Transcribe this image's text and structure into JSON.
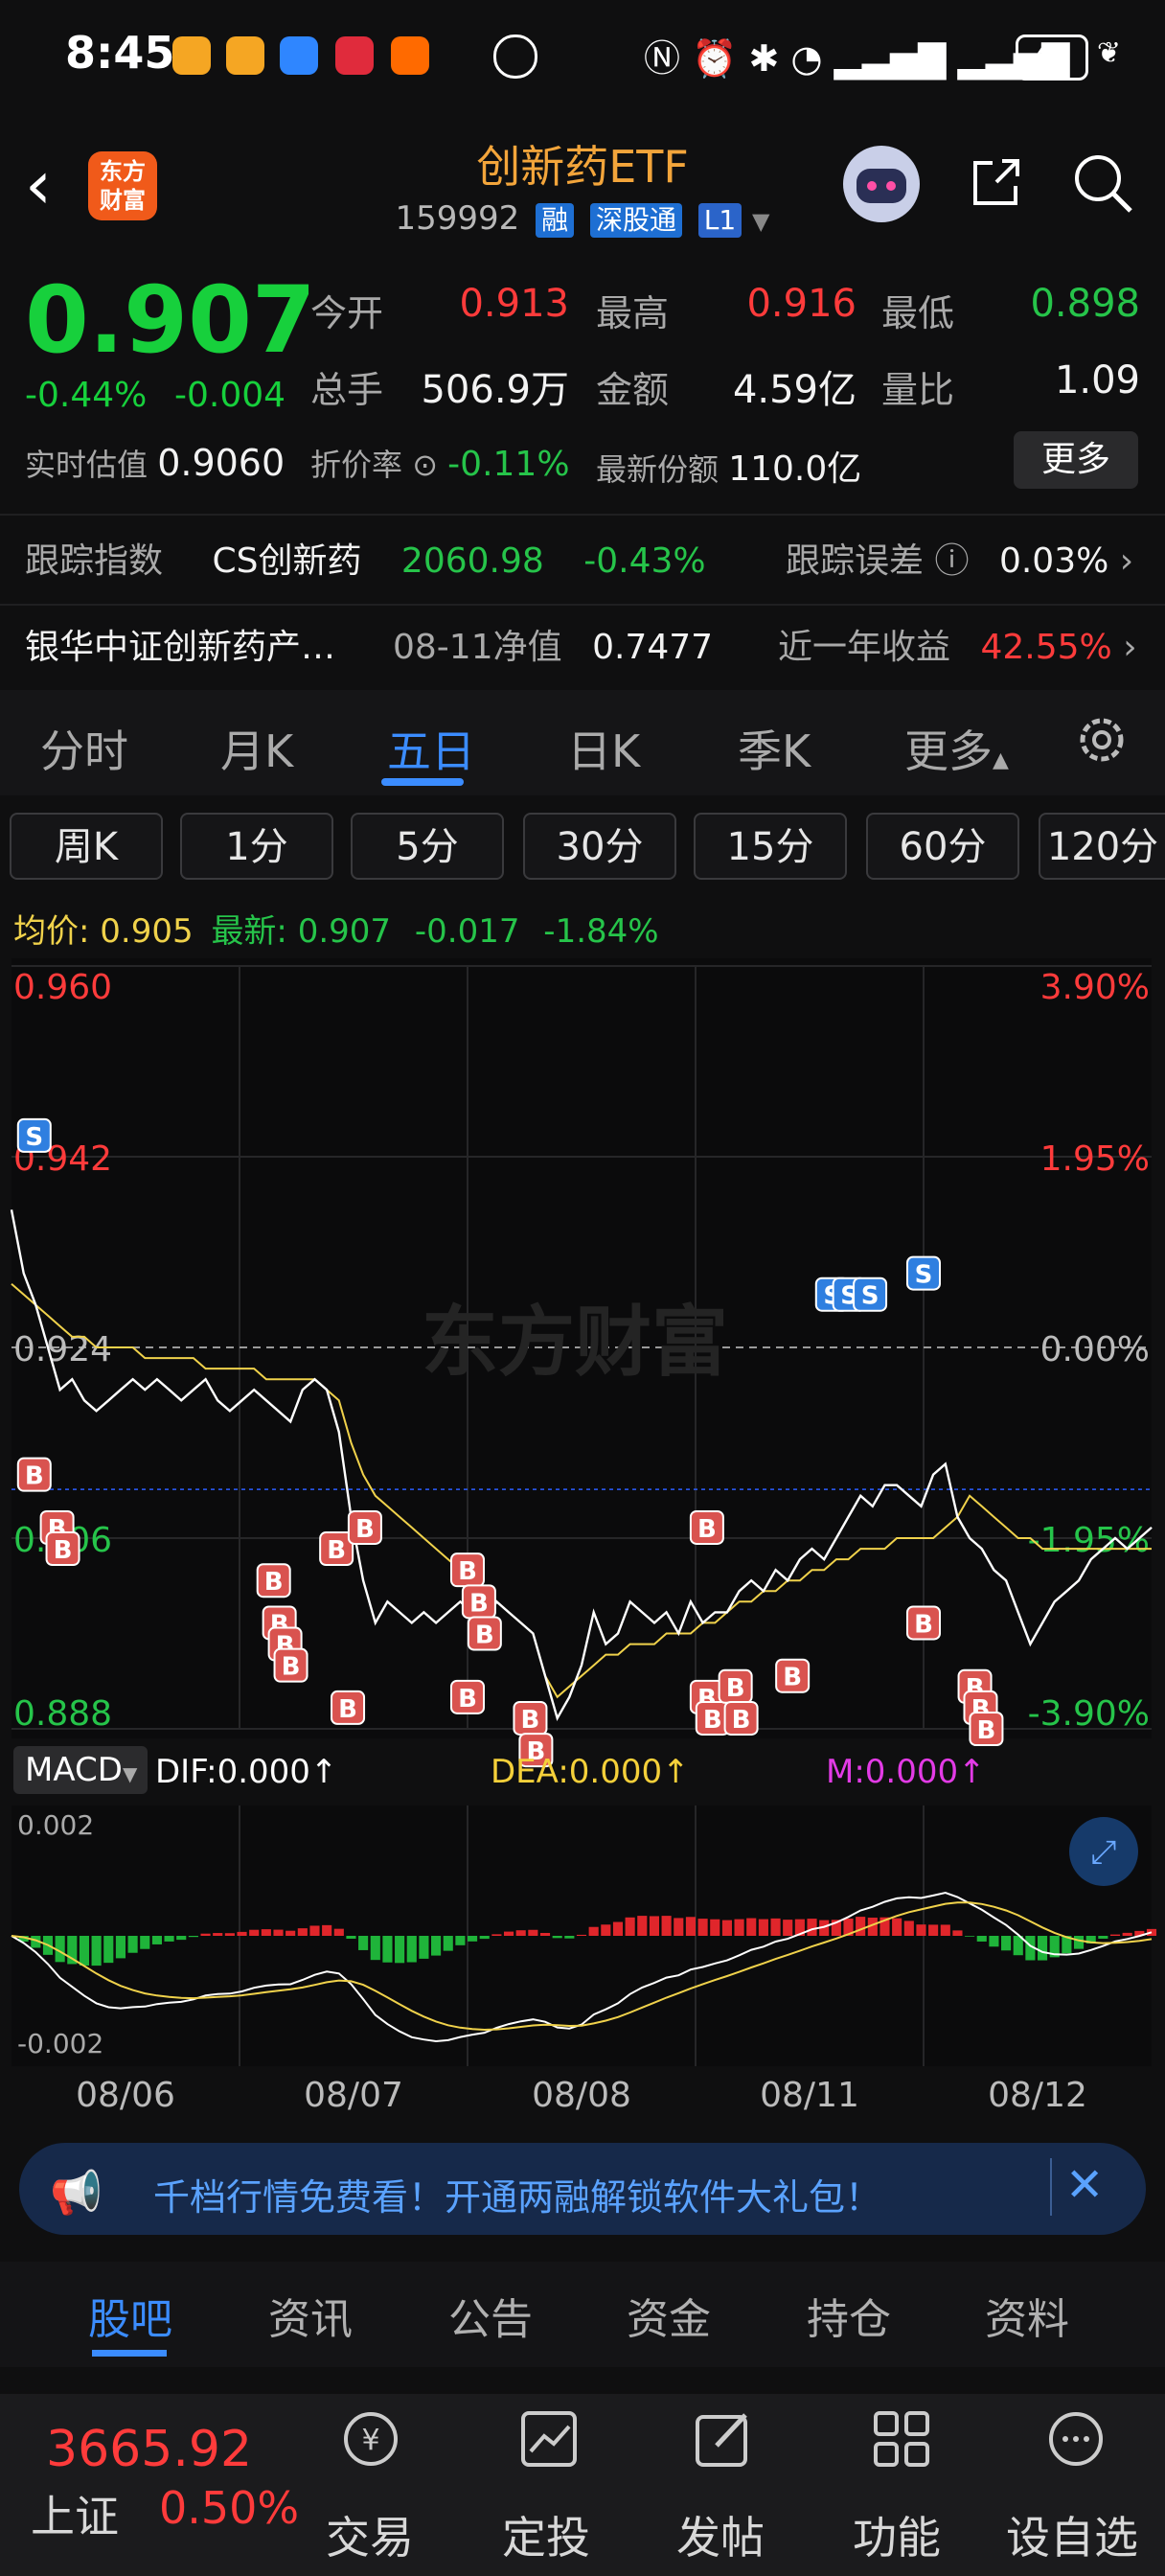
{
  "status": {
    "time": "8:45",
    "battery": "45"
  },
  "header": {
    "title": "创新药ETF",
    "code": "159992",
    "tag_margin": "融",
    "tag_connect": "深股通",
    "tag_level": "L1",
    "logo_line1": "东方",
    "logo_line2": "财富"
  },
  "quote": {
    "price": "0.907",
    "change_pct": "-0.44%",
    "change_abs": "-0.004",
    "open_label": "今开",
    "open": "0.913",
    "high_label": "最高",
    "high": "0.916",
    "low_label": "最低",
    "low": "0.898",
    "volume_label": "总手",
    "volume": "506.9万",
    "amount_label": "金额",
    "amount": "4.59亿",
    "ratio_label": "量比",
    "ratio": "1.09",
    "estimate_label": "实时估值",
    "estimate": "0.9060",
    "premium_label": "折价率",
    "premium": "-0.11%",
    "shares_label": "最新份额",
    "shares": "110.0亿",
    "more": "更多"
  },
  "tracking": {
    "label": "跟踪指数",
    "index_name": "CS创新药",
    "index_value": "2060.98",
    "index_change": "-0.43%",
    "error_label": "跟踪误差",
    "error_value": "0.03%",
    "fund_name": "银华中证创新药产…",
    "nav_label": "08-11净值",
    "nav_value": "0.7477",
    "yearly_label": "近一年收益",
    "yearly_value": "42.55%"
  },
  "tabs": [
    "分时",
    "月K",
    "五日",
    "日K",
    "季K",
    "更多"
  ],
  "periods": [
    "周K",
    "1分",
    "5分",
    "30分",
    "15分",
    "60分",
    "120分"
  ],
  "legend": {
    "avg_label": "均价:",
    "avg": "0.905",
    "last_label": "最新:",
    "last": "0.907",
    "chg": "-0.017",
    "chg_pct": "-1.84%"
  },
  "chart_data": {
    "type": "line",
    "x": [
      "08/06",
      "08/07",
      "08/08",
      "08/11",
      "08/12"
    ],
    "price_ticks": [
      "0.960",
      "0.942",
      "0.924",
      "0.906",
      "0.888"
    ],
    "pct_ticks": [
      "3.90%",
      "1.95%",
      "0.00%",
      "-1.95%",
      "-3.90%"
    ],
    "ylim": [
      0.888,
      0.96
    ],
    "baseline": 0.924,
    "watermark": "东方财富",
    "macd_label": "MACD",
    "dif": "DIF:0.000↑",
    "dea": "DEA:0.000↑",
    "m": "M:0.000↑",
    "macd_ticks": [
      "0.002",
      "-0.002"
    ],
    "series": [
      {
        "values": [
          0.937,
          0.931,
          0.928,
          0.924,
          0.92,
          0.921,
          0.919,
          0.918,
          0.919,
          0.92,
          0.921,
          0.92,
          0.921,
          0.92,
          0.919,
          0.92,
          0.921,
          0.919,
          0.918,
          0.919,
          0.92,
          0.919,
          0.918,
          0.917,
          0.92,
          0.921,
          0.92,
          0.916,
          0.908,
          0.902,
          0.898,
          0.9,
          0.899,
          0.898,
          0.899,
          0.898,
          0.899,
          0.9,
          0.899,
          0.898,
          0.9,
          0.899,
          0.898,
          0.897,
          0.893,
          0.889,
          0.891,
          0.894,
          0.899,
          0.896,
          0.897,
          0.9,
          0.899,
          0.898,
          0.899,
          0.897,
          0.9,
          0.898,
          0.899,
          0.899,
          0.901,
          0.902,
          0.901,
          0.903,
          0.902,
          0.904,
          0.905,
          0.904,
          0.906,
          0.908,
          0.91,
          0.909,
          0.911,
          0.911,
          0.91,
          0.909,
          0.912,
          0.913,
          0.908,
          0.906,
          0.905,
          0.903,
          0.902,
          0.899,
          0.896,
          0.898,
          0.9,
          0.901,
          0.902,
          0.904,
          0.905,
          0.906,
          0.905,
          0.906,
          0.907
        ]
      },
      {
        "values": [
          0.93,
          0.929,
          0.928,
          0.927,
          0.926,
          0.925,
          0.925,
          0.924,
          0.924,
          0.924,
          0.924,
          0.923,
          0.923,
          0.923,
          0.923,
          0.923,
          0.922,
          0.922,
          0.922,
          0.922,
          0.922,
          0.921,
          0.921,
          0.921,
          0.921,
          0.921,
          0.92,
          0.919,
          0.915,
          0.912,
          0.91,
          0.909,
          0.908,
          0.907,
          0.906,
          0.905,
          0.904,
          0.903,
          0.902,
          0.901,
          0.9,
          0.899,
          0.898,
          0.897,
          0.893,
          0.891,
          0.892,
          0.893,
          0.894,
          0.895,
          0.895,
          0.896,
          0.896,
          0.896,
          0.897,
          0.897,
          0.897,
          0.898,
          0.898,
          0.899,
          0.9,
          0.9,
          0.901,
          0.901,
          0.902,
          0.902,
          0.903,
          0.903,
          0.904,
          0.904,
          0.905,
          0.905,
          0.905,
          0.906,
          0.906,
          0.906,
          0.906,
          0.907,
          0.908,
          0.91,
          0.909,
          0.908,
          0.907,
          0.906,
          0.906,
          0.905,
          0.905,
          0.905,
          0.905,
          0.905,
          0.905,
          0.905,
          0.905,
          0.905,
          0.905
        ]
      }
    ]
  },
  "ad": {
    "text": "千档行情免费看！开通两融解锁软件大礼包！"
  },
  "bottom_tabs": [
    "股吧",
    "资讯",
    "公告",
    "资金",
    "持仓",
    "资料"
  ],
  "nav": {
    "index_value": "3665.92",
    "index_name": "上证",
    "index_change": "0.50%",
    "items": [
      "交易",
      "定投",
      "发帖",
      "功能",
      "设自选"
    ]
  },
  "colors": {
    "up": "#ff3b3b",
    "down": "#26c44a",
    "accent": "#3b8cff",
    "title": "#f3a53b",
    "avg_line": "#f0d24b"
  }
}
